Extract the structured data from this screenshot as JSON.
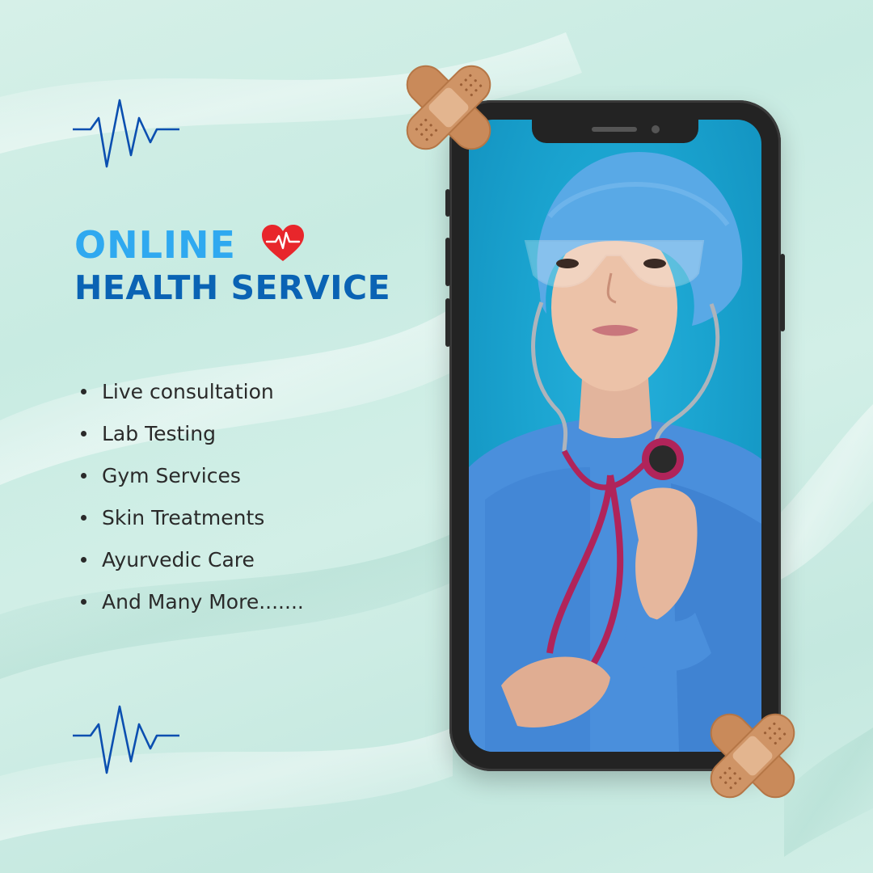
{
  "header": {
    "title_line1": "ONLINE",
    "title_line2": "HEALTH SERVICE"
  },
  "services": [
    "Live consultation",
    "Lab Testing",
    "Gym Services",
    "Skin Treatments",
    "Ayurvedic Care",
    "And Many More......."
  ],
  "icons": {
    "pulse": "heartbeat-line-icon",
    "heart": "heart-pulse-icon",
    "bandage": "bandage-cross-icon"
  },
  "colors": {
    "background": "#cdeee6",
    "title_light": "#2fa9f0",
    "title_dark": "#0a63b4",
    "heart": "#e8262b",
    "pulse_line": "#0b4fb0",
    "bandage": "#c98a5a",
    "phone_body": "#232323",
    "screen_bg": "#1aa3cf"
  }
}
